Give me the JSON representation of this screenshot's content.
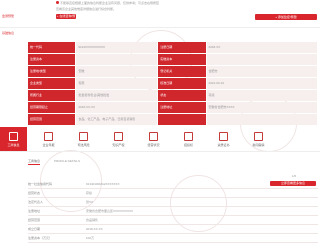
{
  "top": {
    "label": "监测预警",
    "notice_line1": "不能够直接根据上面的信息判断企业没有问题，仅供参考；可点击右侧按钮",
    "notice_line2": "查看该企业其他维度详细信息进行综合判断。",
    "register_button": "+ 在线咨询/预警",
    "monitor_button": "+ 添加监控/预警"
  },
  "section": {
    "title": "基础信息"
  },
  "info_rows": [
    {
      "label1": "统一代码",
      "value1": "9134XXXXXXXXXX",
      "label2": "注册日期",
      "value2": "2018-XX"
    },
    {
      "label1": "注册资本",
      "value1": "",
      "label2": "实缴资本",
      "value2": ""
    },
    {
      "label1": "注册地/类型",
      "value1": "安徽",
      "label2": "登记机关",
      "value2": "合肥市"
    },
    {
      "label1": "企业类型",
      "value1": "有限",
      "label2": "核准日期",
      "value2": "2021-03-19"
    },
    {
      "label1": "所属行业",
      "value1": "批发和零售业/其他批发",
      "label2": "状态",
      "value2": "存续"
    },
    {
      "label1": "经营期限起止",
      "value1": "2018-XX-XX",
      "label2": "注册地址",
      "value2": "安徽省合肥市XXXX"
    },
    {
      "label1": "经营范围",
      "value1": "食品、化工产品、电子产品、日用百货销售",
      "label2": "",
      "value2": ""
    }
  ],
  "tabs": [
    {
      "label": "工商信息",
      "icon": "document-icon",
      "active": true
    },
    {
      "label": "企业年报",
      "icon": "document-icon",
      "active": false
    },
    {
      "label": "司法风险",
      "icon": "gavel-icon",
      "active": false
    },
    {
      "label": "知识产权",
      "icon": "document-icon",
      "active": false
    },
    {
      "label": "经营状况",
      "icon": "document-icon",
      "active": false
    },
    {
      "label": "招投标",
      "icon": "document-icon",
      "active": false
    },
    {
      "label": "资质证书",
      "icon": "document-icon",
      "active": false
    },
    {
      "label": "新闻舆情",
      "icon": "document-icon",
      "active": false
    }
  ],
  "subtabs": [
    {
      "label": "工商信息",
      "active": true
    },
    {
      "label": "PROFILE DETAILS",
      "active": false
    }
  ],
  "pagination": "1/6",
  "detail_rows": [
    {
      "label": "统一社会信用代码",
      "value": "91340100MA2XXXXXXX",
      "button": "立即查看更多信息"
    },
    {
      "label": "经营状态",
      "value": "存续",
      "button": ""
    },
    {
      "label": "法定代表人",
      "value": "张XX",
      "button": ""
    },
    {
      "label": "注册地址",
      "value": "安徽省合肥市蜀山区XXXXXXXXXX",
      "button": ""
    },
    {
      "label": "经营范围",
      "value": "食品销售",
      "button": ""
    },
    {
      "label": "成立日期",
      "value": "2018-XX-XX",
      "button": ""
    },
    {
      "label": "注册资本（万元）",
      "value": "100万",
      "button": ""
    }
  ],
  "colors": {
    "accent": "#d9262c",
    "label_bg": "#d0272d",
    "value_bg": "#f7eeee"
  }
}
